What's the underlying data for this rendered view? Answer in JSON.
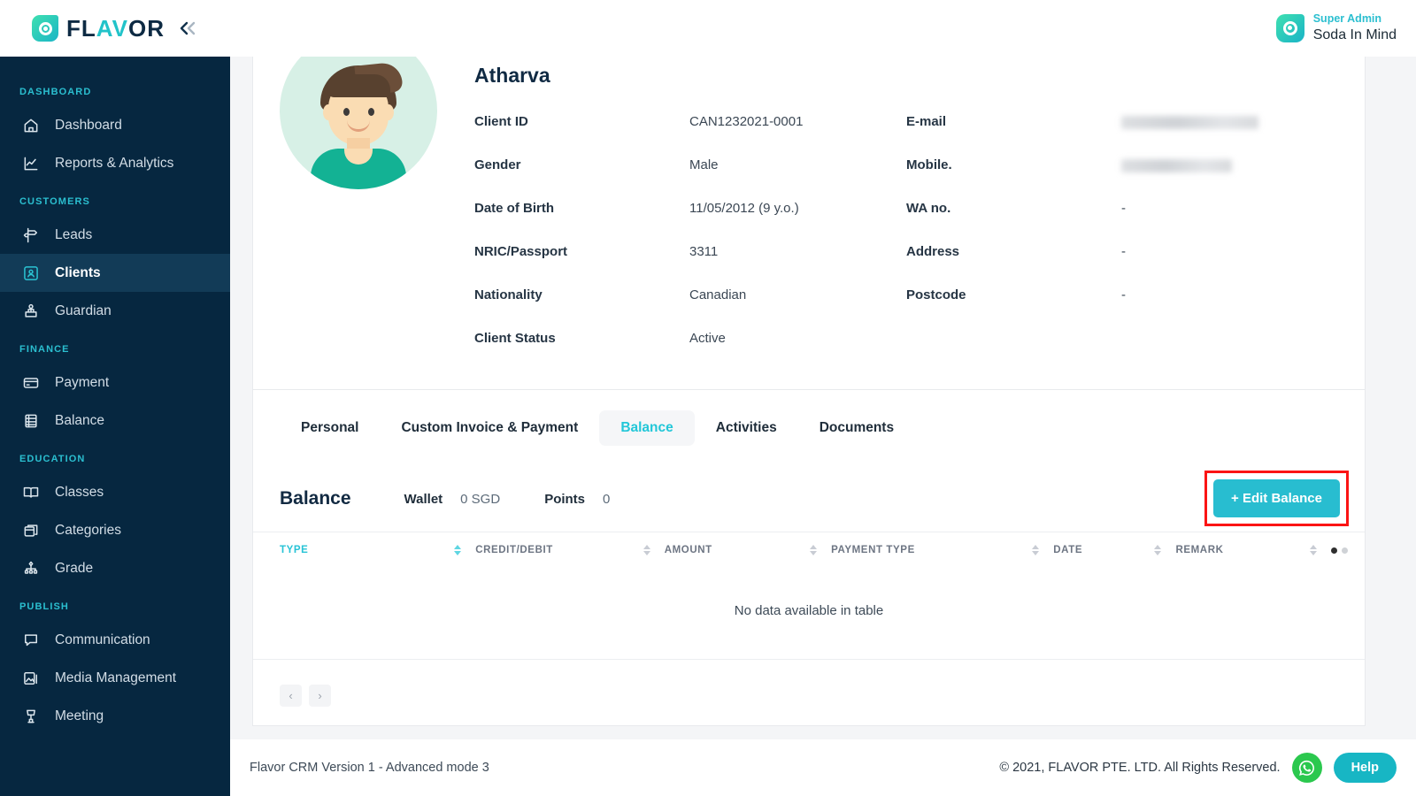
{
  "brand": {
    "name_dark_1": "FL",
    "name_accent": "AV",
    "name_dark_2": "OR",
    "collapse_icon": "chevrons-left-icon"
  },
  "topbar": {
    "role": "Super Admin",
    "account": "Soda In Mind"
  },
  "sidebar": {
    "sections": [
      {
        "label": "DASHBOARD",
        "items": [
          {
            "label": "Dashboard",
            "icon": "home-icon",
            "active": false
          },
          {
            "label": "Reports & Analytics",
            "icon": "chart-line-icon",
            "active": false
          }
        ]
      },
      {
        "label": "CUSTOMERS",
        "items": [
          {
            "label": "Leads",
            "icon": "signpost-icon",
            "active": false
          },
          {
            "label": "Clients",
            "icon": "user-card-icon",
            "active": true
          },
          {
            "label": "Guardian",
            "icon": "guardian-icon",
            "active": false
          }
        ]
      },
      {
        "label": "FINANCE",
        "items": [
          {
            "label": "Payment",
            "icon": "credit-card-icon",
            "active": false
          },
          {
            "label": "Balance",
            "icon": "ledger-icon",
            "active": false
          }
        ]
      },
      {
        "label": "EDUCATION",
        "items": [
          {
            "label": "Classes",
            "icon": "book-icon",
            "active": false
          },
          {
            "label": "Categories",
            "icon": "boxes-icon",
            "active": false
          },
          {
            "label": "Grade",
            "icon": "hierarchy-icon",
            "active": false
          }
        ]
      },
      {
        "label": "PUBLISH",
        "items": [
          {
            "label": "Communication",
            "icon": "chat-icon",
            "active": false
          },
          {
            "label": "Media Management",
            "icon": "image-icon",
            "active": false
          },
          {
            "label": "Meeting",
            "icon": "podium-icon",
            "active": false
          }
        ]
      }
    ]
  },
  "profile": {
    "avatar_icon": "boy-avatar",
    "name": "Atharva",
    "left_fields": [
      {
        "label": "Client ID",
        "value": "CAN1232021-0001"
      },
      {
        "label": "Gender",
        "value": "Male"
      },
      {
        "label": "Date of Birth",
        "value": "11/05/2012 (9 y.o.)"
      },
      {
        "label": "NRIC/Passport",
        "value": "3311"
      },
      {
        "label": "Nationality",
        "value": "Canadian"
      },
      {
        "label": "Client Status",
        "value": "Active"
      }
    ],
    "right_fields": [
      {
        "label": "E-mail",
        "value": "",
        "redacted": true
      },
      {
        "label": "Mobile.",
        "value": "",
        "redacted": true
      },
      {
        "label": "WA no.",
        "value": "-",
        "redacted": false
      },
      {
        "label": "Address",
        "value": "-",
        "redacted": false
      },
      {
        "label": "Postcode",
        "value": "-",
        "redacted": false
      }
    ]
  },
  "tabs": [
    {
      "label": "Personal",
      "active": false
    },
    {
      "label": "Custom Invoice & Payment",
      "active": false
    },
    {
      "label": "Balance",
      "active": true
    },
    {
      "label": "Activities",
      "active": false
    },
    {
      "label": "Documents",
      "active": false
    }
  ],
  "balance": {
    "title": "Balance",
    "wallet_label": "Wallet",
    "wallet_value": "0 SGD",
    "points_label": "Points",
    "points_value": "0",
    "edit_button": "+ Edit Balance",
    "highlight_color": "#fb1414",
    "button_color": "#28bdd0"
  },
  "table": {
    "columns": [
      {
        "label": "TYPE",
        "sorted": true
      },
      {
        "label": "CREDIT/DEBIT",
        "sorted": false
      },
      {
        "label": "AMOUNT",
        "sorted": false
      },
      {
        "label": "PAYMENT TYPE",
        "sorted": false
      },
      {
        "label": "DATE",
        "sorted": false
      },
      {
        "label": "REMARK",
        "sorted": false
      }
    ],
    "empty_message": "No data available in table",
    "pager": {
      "prev": "‹",
      "next": "›"
    }
  },
  "footer": {
    "version": "Flavor CRM Version 1 - Advanced mode 3",
    "copyright": "© 2021, FLAVOR PTE. LTD. All Rights Reserved.",
    "whatsapp_icon": "whatsapp-icon",
    "help_label": "Help"
  }
}
